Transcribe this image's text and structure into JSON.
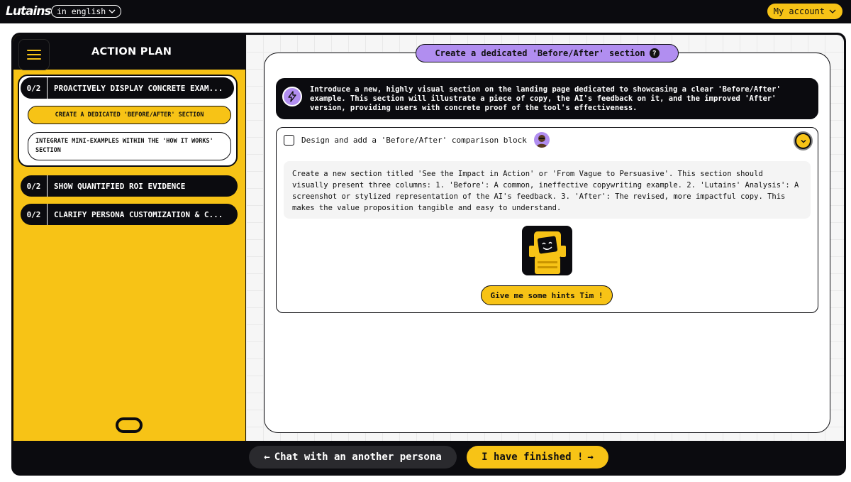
{
  "header": {
    "logo_text": "Lutains",
    "language_label": "in english",
    "account_label": "My account"
  },
  "sidebar": {
    "title": "ACTION PLAN",
    "groups": [
      {
        "count": "0/2",
        "label": "PROACTIVELY DISPLAY CONCRETE EXAM...",
        "expanded": true,
        "subitems": [
          {
            "label": "CREATE A DEDICATED 'BEFORE/AFTER' SECTION",
            "active": true
          },
          {
            "label": "INTEGRATE MINI-EXAMPLES WITHIN THE 'HOW IT WORKS' SECTION",
            "active": false
          }
        ]
      },
      {
        "count": "0/2",
        "label": "SHOW QUANTIFIED ROI EVIDENCE"
      },
      {
        "count": "0/2",
        "label": "CLARIFY PERSONA CUSTOMIZATION & C..."
      }
    ]
  },
  "main": {
    "section_title": "Create a dedicated 'Before/After' section",
    "intro_text": "Introduce a new, highly visual section on the landing page dedicated to showcasing a clear 'Before/After' example. This section will illustrate a piece of copy, the AI's feedback on it, and the improved 'After' version, providing users with concrete proof of the tool's effectiveness.",
    "task": {
      "title": "Design and add a 'Before/After' comparison block",
      "description": "Create a new section titled 'See the Impact in Action' or 'From Vague to Persuasive'. This section should visually present three columns: 1. 'Before': A common, ineffective copywriting example. 2. 'Lutains' Analysis': A screenshot or stylized representation of the AI's feedback. 3. 'After': The revised, more impactful copy. This makes the value proposition tangible and easy to understand.",
      "hint_label": "Give me some hints Tim !"
    }
  },
  "footer": {
    "back_label": "Chat with an another persona",
    "finish_label": "I have finished !"
  },
  "colors": {
    "accent": "#f7c316",
    "dark": "#0b0b0f",
    "purple": "#b18ef0"
  }
}
